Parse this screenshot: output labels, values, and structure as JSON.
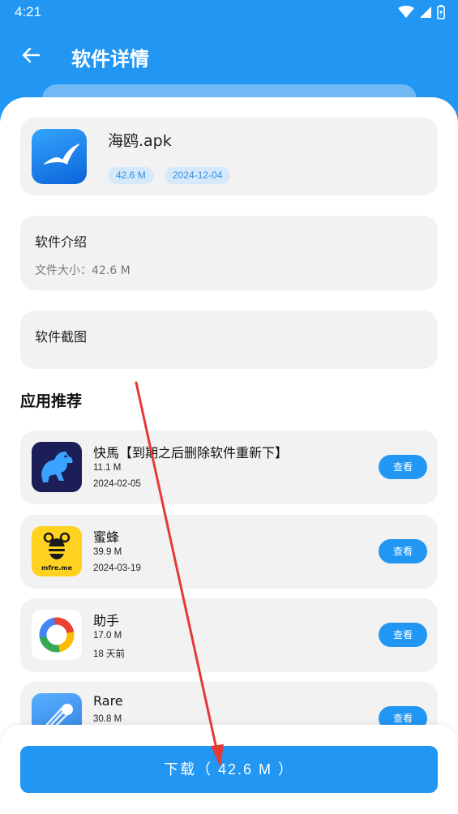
{
  "status": {
    "time": "4:21"
  },
  "appbar": {
    "title": "软件详情"
  },
  "app": {
    "name": "海鸥.apk",
    "size_tag": "42.6 M",
    "date_tag": "2024-12-04"
  },
  "intro": {
    "title": "软件介绍",
    "size_text": "文件大小：42.6 M"
  },
  "screenshots": {
    "title": "软件截图"
  },
  "recommend": {
    "heading": "应用推荐",
    "view_label": "查看",
    "items": [
      {
        "name": "快馬【到期之后删除软件重新下】",
        "size": "11.1 M",
        "date": "2024-02-05",
        "icon": "horse-icon"
      },
      {
        "name": "蜜蜂",
        "size": "39.9 M",
        "date": "2024-03-19",
        "icon": "bee-icon",
        "icon_text": "mfre.me"
      },
      {
        "name": "助手",
        "size": "17.0 M",
        "date": "18 天前",
        "icon": "ring-icon"
      },
      {
        "name": "Rare",
        "size": "30.8 M",
        "date": "",
        "icon": "comet-icon"
      }
    ]
  },
  "download": {
    "label": "下载（ 42.6 M ）"
  },
  "colors": {
    "primary": "#2196F3",
    "card": "#f2f2f2",
    "tag_bg": "#d6e9fb",
    "annotation": "#e53935"
  }
}
